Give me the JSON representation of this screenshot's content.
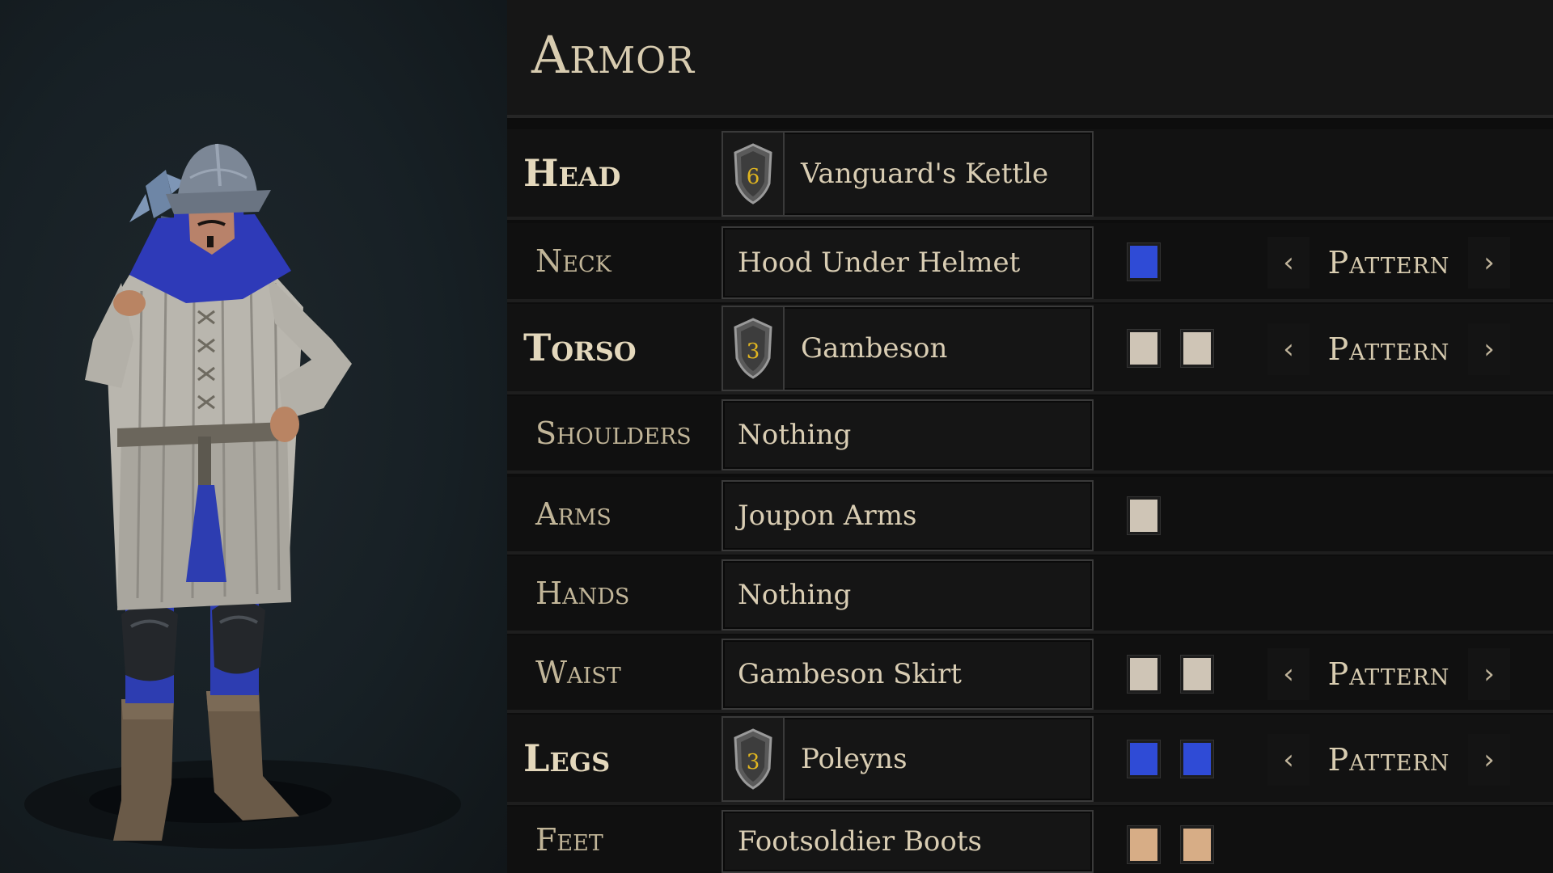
{
  "panel": {
    "title": "Armor"
  },
  "slots": {
    "head": {
      "label": "Head",
      "item": "Vanguard's Kettle",
      "tier": "6"
    },
    "neck": {
      "label": "Neck",
      "item": "Hood Under Helmet",
      "colors": [
        "#2f4bd6"
      ],
      "pattern_label": "Pattern"
    },
    "torso": {
      "label": "Torso",
      "item": "Gambeson",
      "tier": "3",
      "colors": [
        "#cfc5b6",
        "#cfc5b6"
      ],
      "pattern_label": "Pattern"
    },
    "shoulders": {
      "label": "Shoulders",
      "item": "Nothing"
    },
    "arms": {
      "label": "Arms",
      "item": "Joupon Arms",
      "colors": [
        "#cfc5b6"
      ]
    },
    "hands": {
      "label": "Hands",
      "item": "Nothing"
    },
    "waist": {
      "label": "Waist",
      "item": "Gambeson Skirt",
      "colors": [
        "#cfc5b6",
        "#cfc5b6"
      ],
      "pattern_label": "Pattern"
    },
    "legs": {
      "label": "Legs",
      "item": "Poleyns",
      "tier": "3",
      "colors": [
        "#2f4bd6",
        "#2f4bd6"
      ],
      "pattern_label": "Pattern"
    },
    "feet": {
      "label": "Feet",
      "item": "Footsoldier Boots",
      "colors": [
        "#d7ad86",
        "#d7ad86"
      ]
    }
  },
  "icons": {
    "prev": "chevron-left-icon",
    "next": "chevron-right-icon",
    "tier": "shield-icon"
  },
  "theme": {
    "accent": "#d8ccb0",
    "tier_number": "#e0b520"
  }
}
